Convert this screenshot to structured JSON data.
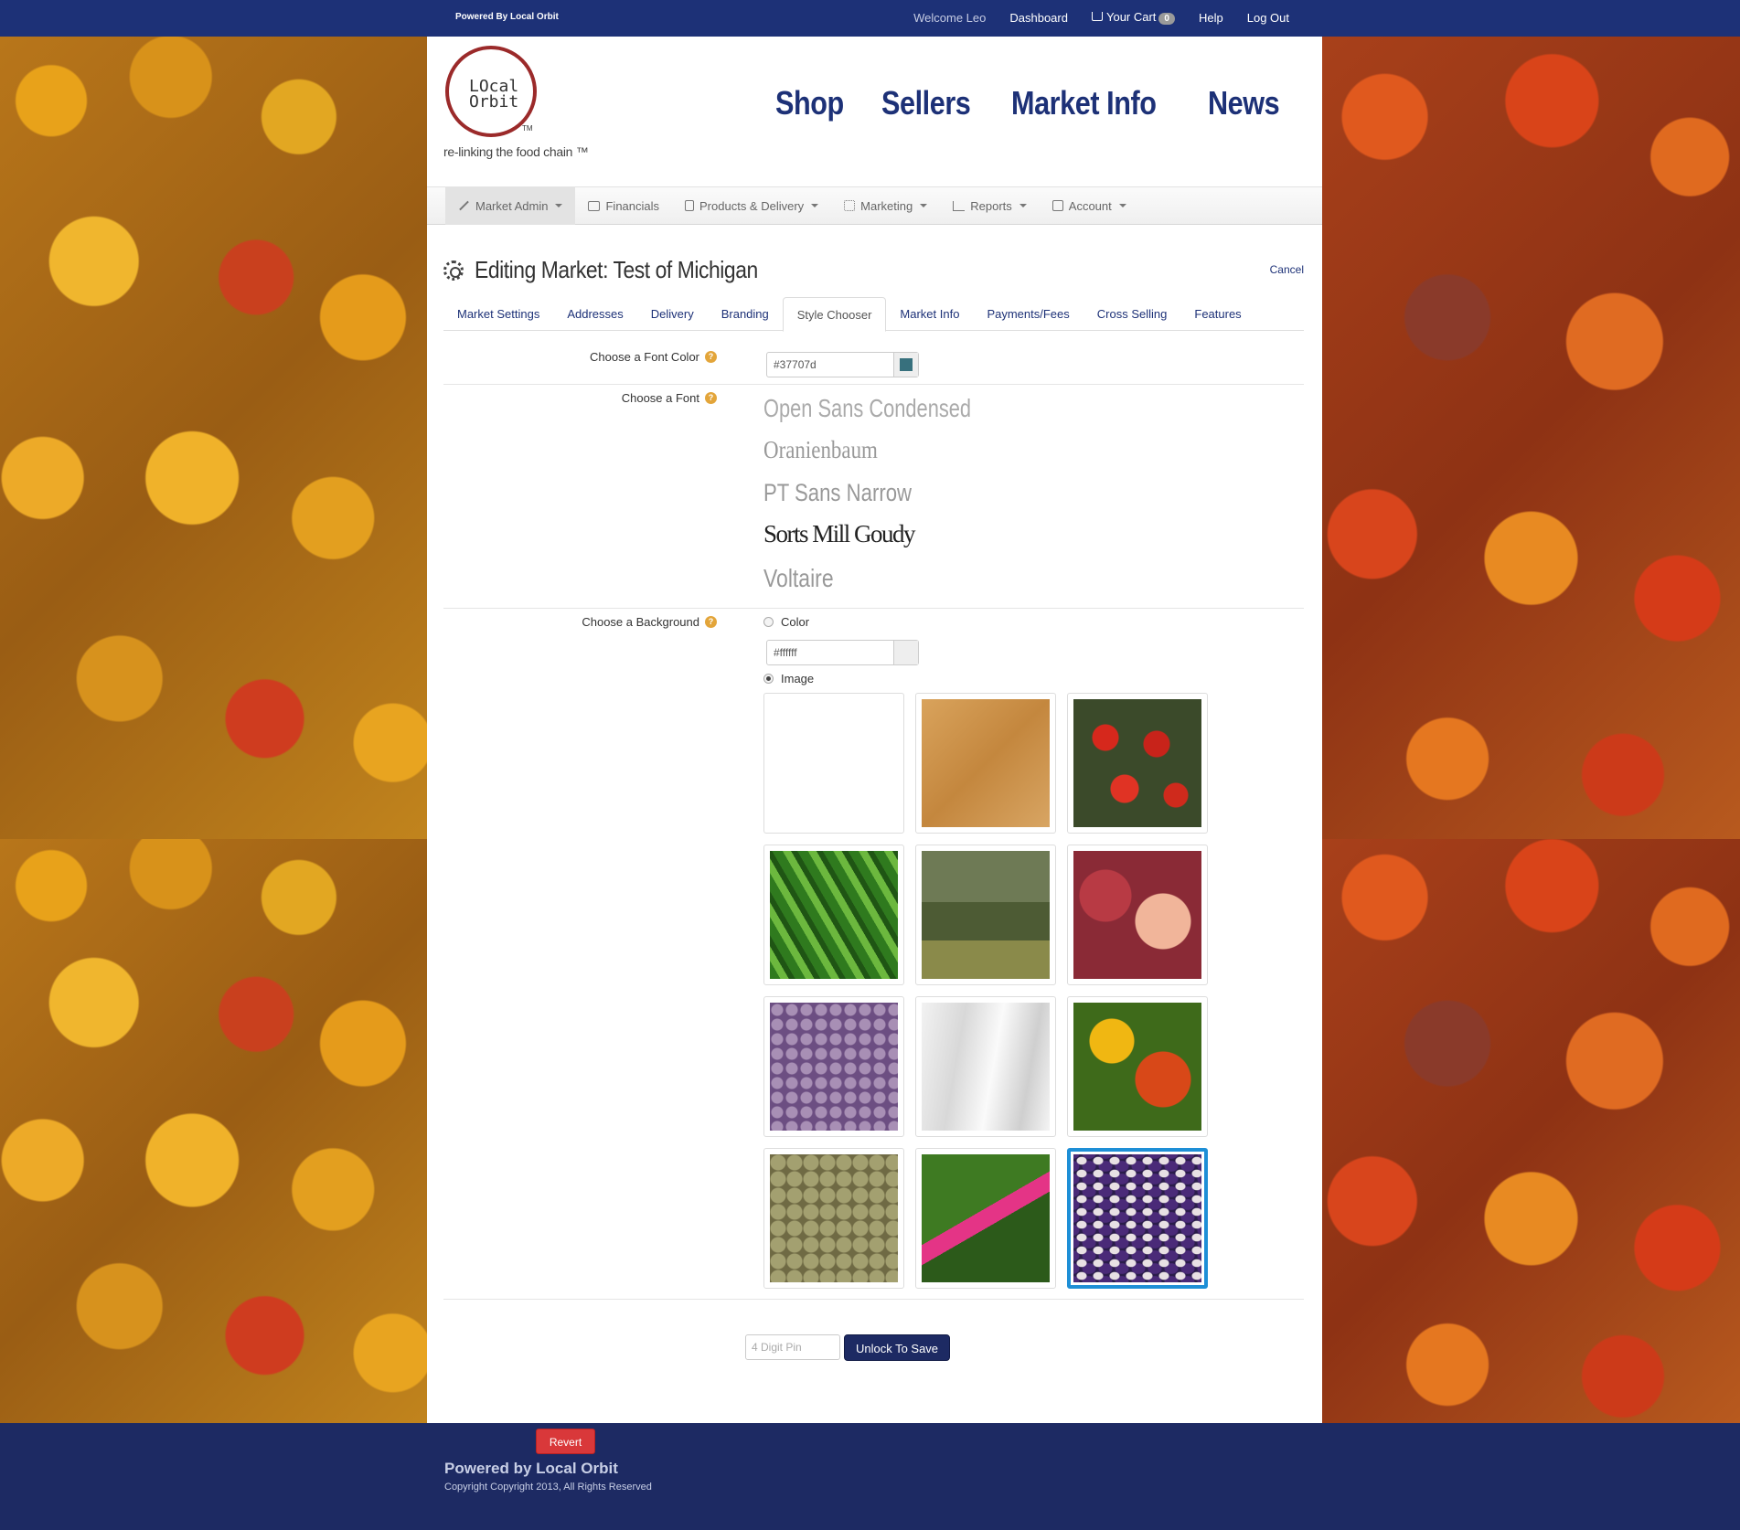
{
  "topbar": {
    "powered": "Powered By Local Orbit",
    "welcome": "Welcome Leo",
    "dashboard": "Dashboard",
    "cart": "Your Cart",
    "cart_count": "0",
    "help": "Help",
    "logout": "Log Out"
  },
  "logo": {
    "line1": "LOcal",
    "line2": "Orbit",
    "tm": "TM",
    "tagline": "re-linking the food chain ™"
  },
  "mainnav": [
    "Shop",
    "Sellers",
    "Market Info",
    "News"
  ],
  "adminbar": [
    {
      "label": "Market Admin",
      "icon": "magic-wand-icon",
      "dropdown": true
    },
    {
      "label": "Financials",
      "icon": "money-icon",
      "dropdown": false
    },
    {
      "label": "Products & Delivery",
      "icon": "checklist-icon",
      "dropdown": true
    },
    {
      "label": "Marketing",
      "icon": "qr-icon",
      "dropdown": true
    },
    {
      "label": "Reports",
      "icon": "bar-chart-icon",
      "dropdown": true
    },
    {
      "label": "Account",
      "icon": "account-icon",
      "dropdown": true
    }
  ],
  "page": {
    "title": "Editing Market: Test of Michigan",
    "cancel": "Cancel"
  },
  "tabs": [
    "Market Settings",
    "Addresses",
    "Delivery",
    "Branding",
    "Style Chooser",
    "Market Info",
    "Payments/Fees",
    "Cross Selling",
    "Features"
  ],
  "active_tab": "Style Chooser",
  "style": {
    "font_color_label": "Choose a Font Color",
    "font_color_value": "#37707d",
    "font_label": "Choose a Font",
    "fonts": [
      "Open Sans Condensed",
      "Oranienbaum",
      "PT Sans Narrow",
      "Sorts Mill Goudy",
      "Voltaire"
    ],
    "background_label": "Choose a Background",
    "bg_option_color": "Color",
    "bg_color_value": "#ffffff",
    "bg_option_image": "Image",
    "bg_selected": "image",
    "background_images": [
      "blank",
      "paper",
      "tomatoes",
      "greens",
      "painting",
      "peaches",
      "potatoes",
      "leeks",
      "peppers",
      "lentils",
      "chard",
      "beans"
    ],
    "selected_image": "beans"
  },
  "save": {
    "pin_placeholder": "4 Digit Pin",
    "unlock": "Unlock To Save"
  },
  "footer": {
    "revert": "Revert",
    "title": "Powered by Local Orbit",
    "copyright": "Copyright Copyright 2013, All Rights Reserved"
  },
  "colors": {
    "brand": "#1d3177",
    "footer": "#1d2a63",
    "accent_selected": "#1e8fd6",
    "revert": "#d9383a"
  }
}
